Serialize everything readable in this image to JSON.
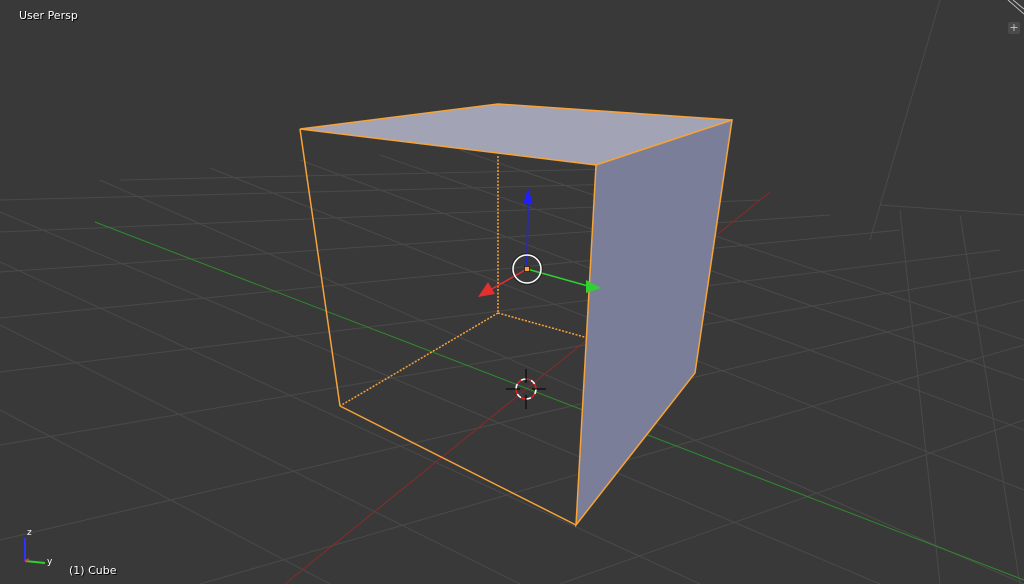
{
  "viewport": {
    "view_label": "User Persp",
    "object_label": "(1) Cube",
    "split_widget_glyph": "+",
    "colors": {
      "background": "#393939",
      "grid_line": "#4a4a4a",
      "x_axis": "#8a2a2a",
      "y_axis": "#2e8a2e",
      "selection_outline": "#f5a33a",
      "cube_face_top": "#a3a3b6",
      "cube_face_side": "#7b7e99",
      "manipulator_x": "#e03030",
      "manipulator_y": "#30d030",
      "manipulator_z": "#2020ff"
    }
  },
  "orientation_gizmo": {
    "z_label": "z",
    "y_label": "y"
  },
  "objects": [
    {
      "name": "Cube",
      "selected": true,
      "display": "solid with wire"
    }
  ],
  "icons": [
    "3d-cursor-icon",
    "object-origin-icon",
    "transform-manipulator-icon",
    "axis-orientation-icon",
    "area-split-icon"
  ]
}
